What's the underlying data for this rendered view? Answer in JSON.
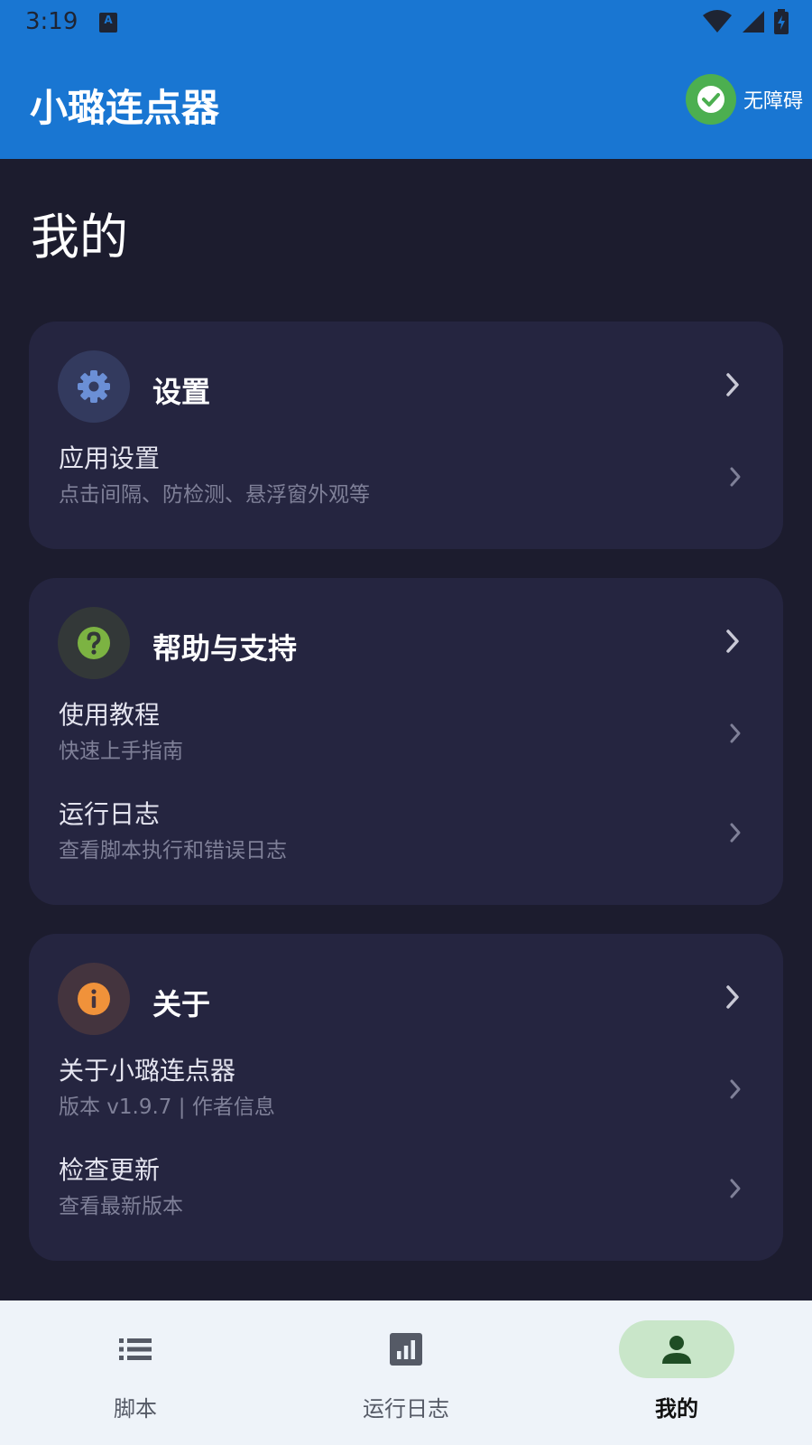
{
  "status": {
    "time": "3:19",
    "a_badge": "A"
  },
  "app_bar": {
    "title": "小璐连点器",
    "accessibility_label": "无障碍"
  },
  "page": {
    "title": "我的"
  },
  "sections": {
    "settings": {
      "title": "设置",
      "items": [
        {
          "title": "应用设置",
          "subtitle": "点击间隔、防检测、悬浮窗外观等"
        }
      ]
    },
    "help": {
      "title": "帮助与支持",
      "items": [
        {
          "title": "使用教程",
          "subtitle": "快速上手指南"
        },
        {
          "title": "运行日志",
          "subtitle": "查看脚本执行和错误日志"
        }
      ]
    },
    "about": {
      "title": "关于",
      "items": [
        {
          "title": "关于小璐连点器",
          "subtitle": "版本 v1.9.7 | 作者信息"
        },
        {
          "title": "检查更新",
          "subtitle": "查看最新版本"
        }
      ]
    }
  },
  "bottom_nav": {
    "items": [
      {
        "label": "脚本",
        "icon": "list-icon"
      },
      {
        "label": "运行日志",
        "icon": "chart-icon"
      },
      {
        "label": "我的",
        "icon": "person-icon",
        "active": true
      }
    ]
  },
  "colors": {
    "primary": "#1976d2",
    "background": "#1c1c2e",
    "card": "#252540",
    "settings_icon": "#6b8fd6",
    "help_icon": "#7cb342",
    "about_icon": "#f0923a",
    "accessibility_ok": "#4caf50",
    "nav_active_pill": "#c9e6c9"
  }
}
